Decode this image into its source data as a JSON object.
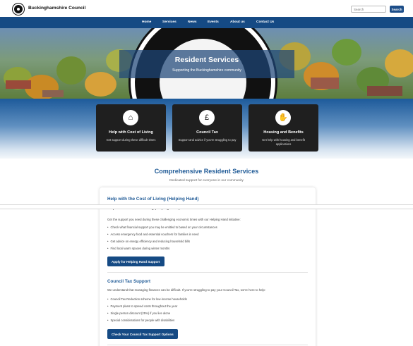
{
  "header": {
    "site_name": "Buckinghamshire Council",
    "search_placeholder": "Search",
    "search_button": "Search"
  },
  "nav": [
    {
      "label": "Home"
    },
    {
      "label": "Services"
    },
    {
      "label": "News"
    },
    {
      "label": "Events"
    },
    {
      "label": "About us"
    },
    {
      "label": "Contact Us"
    }
  ],
  "hero": {
    "title": "Resident Services",
    "subtitle": "Supporting the Buckinghamshire community"
  },
  "service_cards": [
    {
      "icon": "house-icon",
      "title": "Help with Cost of Living",
      "desc": "Get support during these difficult times"
    },
    {
      "icon": "council-tax-document-icon",
      "title": "Council Tax",
      "desc": "Support and advice if you're struggling to pay"
    },
    {
      "icon": "helping-hand-icon",
      "title": "Housing and Benefits",
      "desc": "Get help with housing and benefit applications"
    }
  ],
  "section": {
    "title": "Comprehensive Resident Services",
    "subtitle": "Dedicated support for everyone in our community"
  },
  "cost_of_living": {
    "heading": "Help with the Cost of Living (Helping Hand)",
    "intro": "Get the support you need during these challenging economic times with our Helping Hand initiative:",
    "bullets": [
      "Check what financial support you may be entitled to based on your circumstances",
      "Access emergency food and essential vouchers for families in need",
      "Get advice on energy efficiency and reducing household bills",
      "Find local warm spaces during winter months"
    ],
    "button": "Apply for Helping Hand Support"
  },
  "council_tax": {
    "heading": "Council Tax Support",
    "intro": "We understand that managing finances can be difficult. If you're struggling to pay your Council Tax, we're here to help:",
    "bullets": [
      "Council Tax Reduction scheme for low-income households",
      "Payment plans to spread costs throughout the year",
      "Single person discount (25%) if you live alone",
      "Special considerations for people with disabilities"
    ],
    "button": "Check Your Council Tax Support Options"
  },
  "colors": {
    "brand_blue": "#154a84",
    "heading_blue": "#1f5a96",
    "card_dark": "#1f1f1f"
  }
}
